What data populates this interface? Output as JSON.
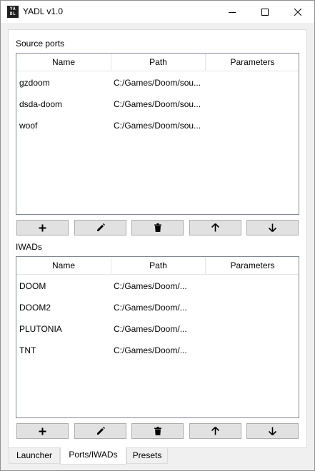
{
  "window": {
    "title": "YADL v1.0",
    "icon_text": "YA DL",
    "icon": "yadl-app-icon",
    "minimize_icon": "minimize-icon",
    "maximize_icon": "maximize-icon",
    "close_icon": "close-icon"
  },
  "source_ports": {
    "label": "Source ports",
    "columns": [
      "Name",
      "Path",
      "Parameters"
    ],
    "rows": [
      {
        "name": "gzdoom",
        "path": "C:/Games/Doom/sou...",
        "parameters": ""
      },
      {
        "name": "dsda-doom",
        "path": "C:/Games/Doom/sou...",
        "parameters": ""
      },
      {
        "name": "woof",
        "path": "C:/Games/Doom/sou...",
        "parameters": ""
      }
    ],
    "buttons": [
      "plus-icon",
      "pencil-icon",
      "trash-icon",
      "arrow-up-icon",
      "arrow-down-icon"
    ]
  },
  "iwads": {
    "label": "IWADs",
    "columns": [
      "Name",
      "Path",
      "Parameters"
    ],
    "rows": [
      {
        "name": "DOOM",
        "path": "C:/Games/Doom/...",
        "parameters": ""
      },
      {
        "name": "DOOM2",
        "path": "C:/Games/Doom/...",
        "parameters": ""
      },
      {
        "name": "PLUTONIA",
        "path": "C:/Games/Doom/...",
        "parameters": ""
      },
      {
        "name": "TNT",
        "path": "C:/Games/Doom/...",
        "parameters": ""
      }
    ],
    "buttons": [
      "plus-icon",
      "pencil-icon",
      "trash-icon",
      "arrow-up-icon",
      "arrow-down-icon"
    ]
  },
  "tabs": [
    {
      "label": "Launcher",
      "active": false
    },
    {
      "label": "Ports/IWADs",
      "active": true
    },
    {
      "label": "Presets",
      "active": false
    }
  ]
}
